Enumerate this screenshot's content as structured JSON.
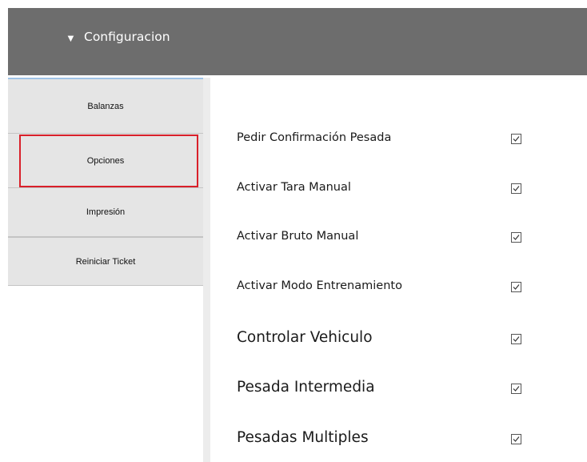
{
  "header": {
    "title": "Configuracion",
    "toggle_icon": "triangle-down-icon",
    "background": "#6d6d6d"
  },
  "sidebar": {
    "items": [
      {
        "label": "Balanzas"
      },
      {
        "label": "Opciones",
        "highlighted": true
      },
      {
        "label": "Impresión"
      },
      {
        "label": "Reiniciar Ticket"
      }
    ],
    "highlight_color": "#d9202a"
  },
  "options": [
    {
      "label": "Pedir Confirmación Pesada",
      "checked": true
    },
    {
      "label": "Activar Tara Manual",
      "checked": true
    },
    {
      "label": "Activar Bruto Manual",
      "checked": true
    },
    {
      "label": "Activar Modo Entrenamiento",
      "checked": true
    },
    {
      "label": "Controlar Vehiculo",
      "checked": true
    },
    {
      "label": "Pesada Intermedia",
      "checked": true
    },
    {
      "label": "Pesadas Multiples",
      "checked": true
    }
  ]
}
